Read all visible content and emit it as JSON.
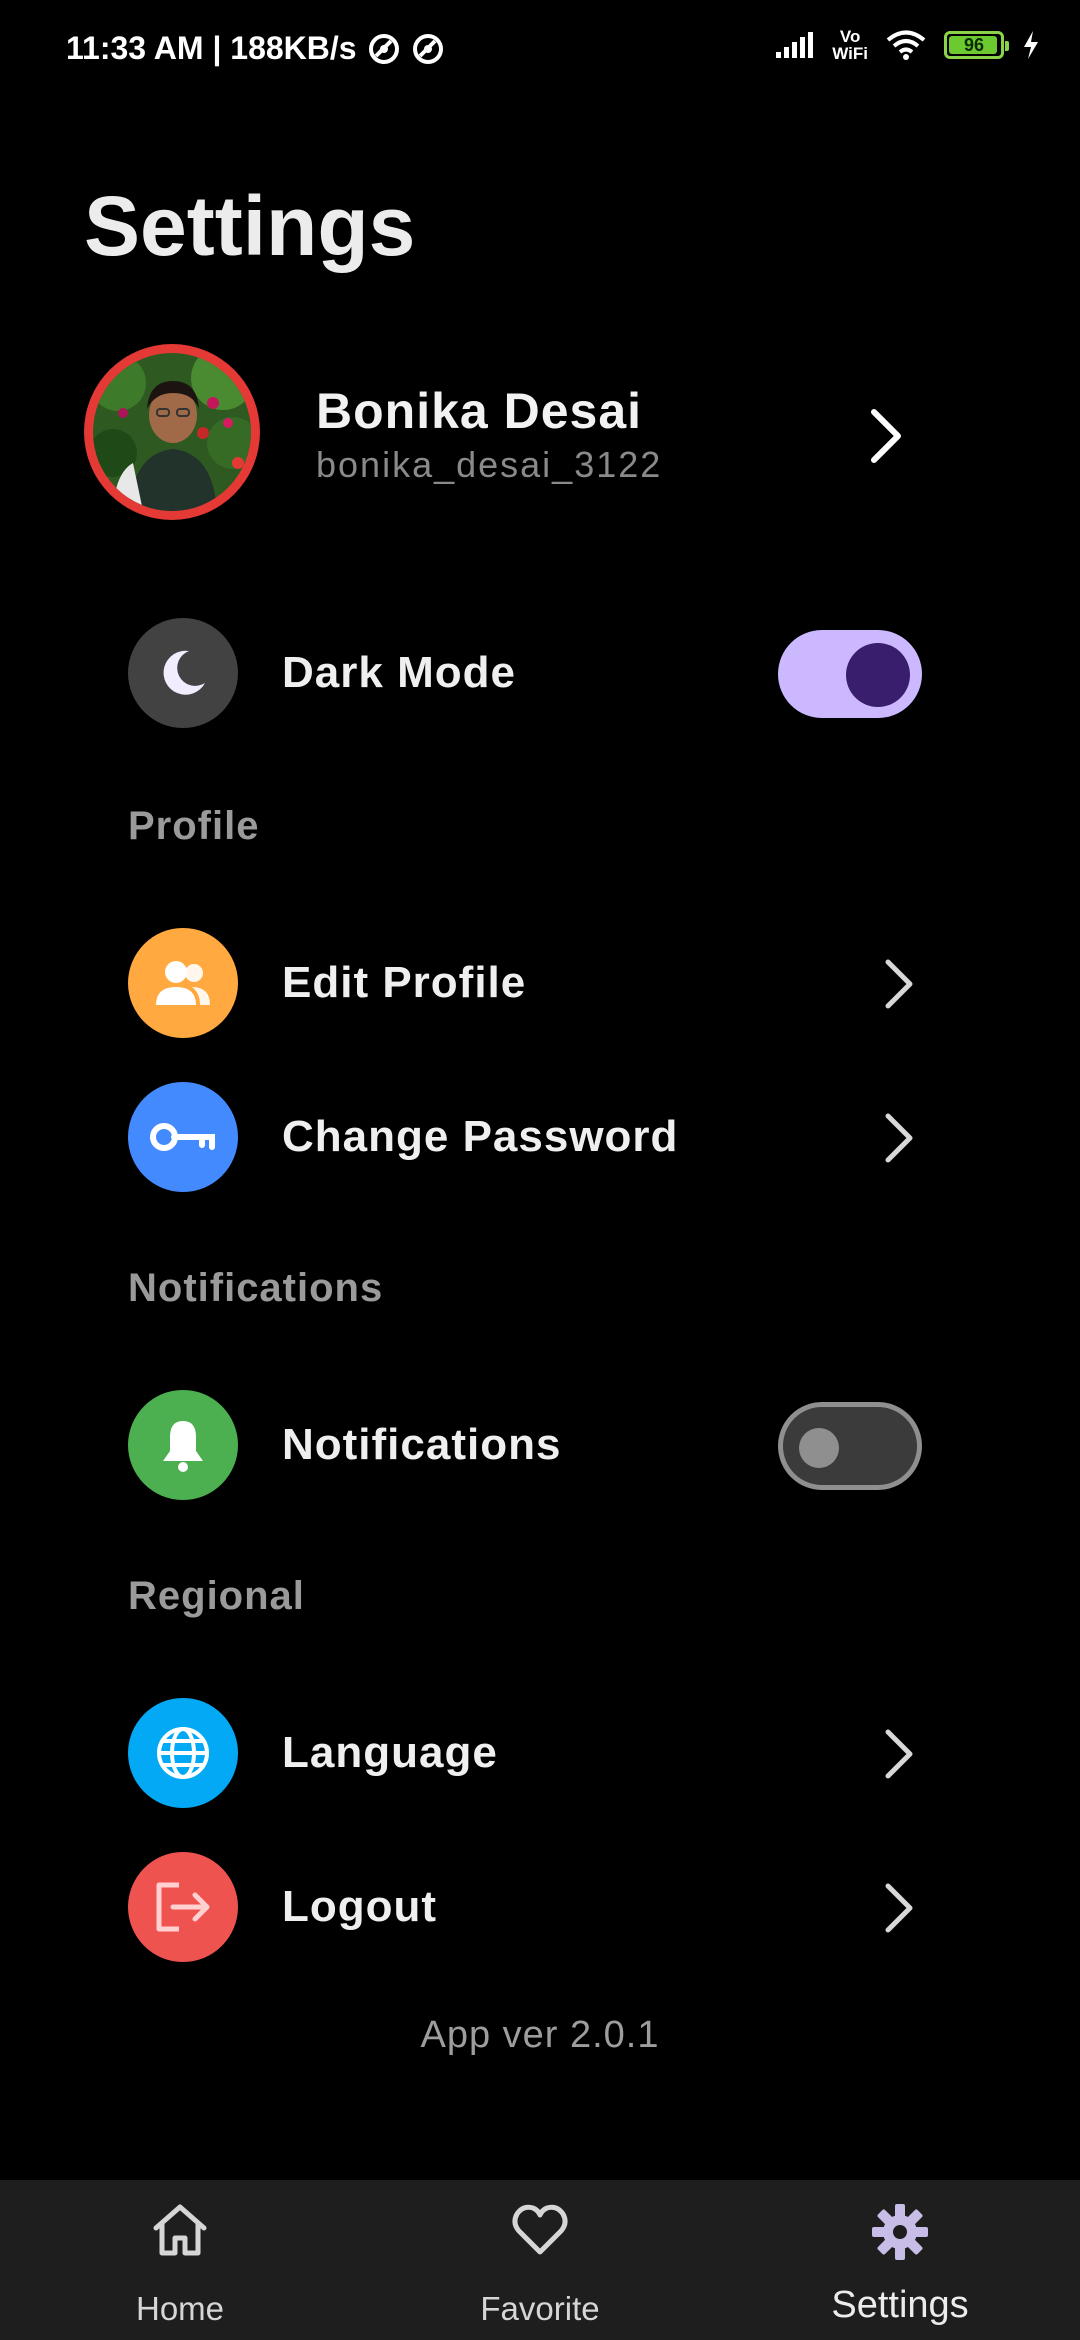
{
  "status_bar": {
    "time": "11:33 AM | 188KB/s",
    "vowifi_top": "Vo",
    "vowifi_bottom": "WiFi",
    "battery_level": "96"
  },
  "page": {
    "title": "Settings"
  },
  "user": {
    "name": "Bonika Desai",
    "handle": "bonika_desai_3122"
  },
  "dark_mode": {
    "label": "Dark Mode",
    "enabled": true,
    "icon": "moon-icon",
    "icon_bg": "#424242"
  },
  "sections": {
    "profile": {
      "header": "Profile",
      "items": [
        {
          "label": "Edit Profile",
          "icon": "people-icon",
          "icon_bg": "#ffa940"
        },
        {
          "label": "Change Password",
          "icon": "key-icon",
          "icon_bg": "#448aff"
        }
      ]
    },
    "notifications": {
      "header": "Notifications",
      "item": {
        "label": "Notifications",
        "enabled": false,
        "icon": "bell-icon",
        "icon_bg": "#4caf50"
      }
    },
    "regional": {
      "header": "Regional",
      "items": [
        {
          "label": "Language",
          "icon": "globe-icon",
          "icon_bg": "#03a9f4"
        },
        {
          "label": "Logout",
          "icon": "logout-icon",
          "icon_bg": "#ef5350"
        }
      ]
    }
  },
  "app_version": "App ver 2.0.1",
  "bottom_nav": {
    "items": [
      {
        "label": "Home",
        "icon": "home-icon"
      },
      {
        "label": "Favorite",
        "icon": "heart-icon"
      },
      {
        "label": "Settings",
        "icon": "gear-icon",
        "active": true
      }
    ]
  },
  "colors": {
    "background": "#000000",
    "nav_background": "#1e1e1e",
    "toggle_on_track": "#cbb8ff",
    "toggle_on_knob": "#3a1e6e",
    "avatar_ring": "#e53935"
  }
}
